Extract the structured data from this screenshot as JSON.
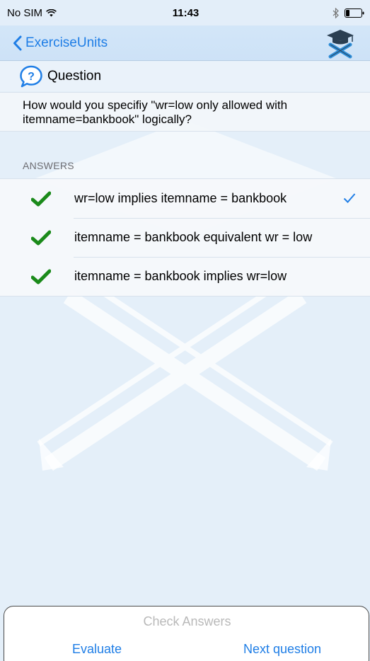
{
  "status_bar": {
    "carrier": "No SIM",
    "time": "11:43"
  },
  "nav": {
    "back_label": "ExerciseUnits",
    "logo_icon": "graduation-cap-pencils-icon"
  },
  "question": {
    "title": "Question",
    "text": "How would you specifiy \"wr=low only allowed with itemname=bankbook\" logically?"
  },
  "answers": {
    "section_label": "ANSWERS",
    "items": [
      {
        "label": "wr=low implies itemname = bankbook",
        "correct": true,
        "selected": true
      },
      {
        "label": "itemname = bankbook equivalent wr = low",
        "correct": true,
        "selected": false
      },
      {
        "label": "itemname = bankbook implies wr=low",
        "correct": true,
        "selected": false
      }
    ]
  },
  "bottom": {
    "check_answers": "Check Answers",
    "evaluate": "Evaluate",
    "next_question": "Next question"
  },
  "colors": {
    "accent": "#1f7ee6",
    "correct_green": "#1a8a1a",
    "background": "#e4eff9",
    "disabled_text": "#b9b9b9"
  }
}
